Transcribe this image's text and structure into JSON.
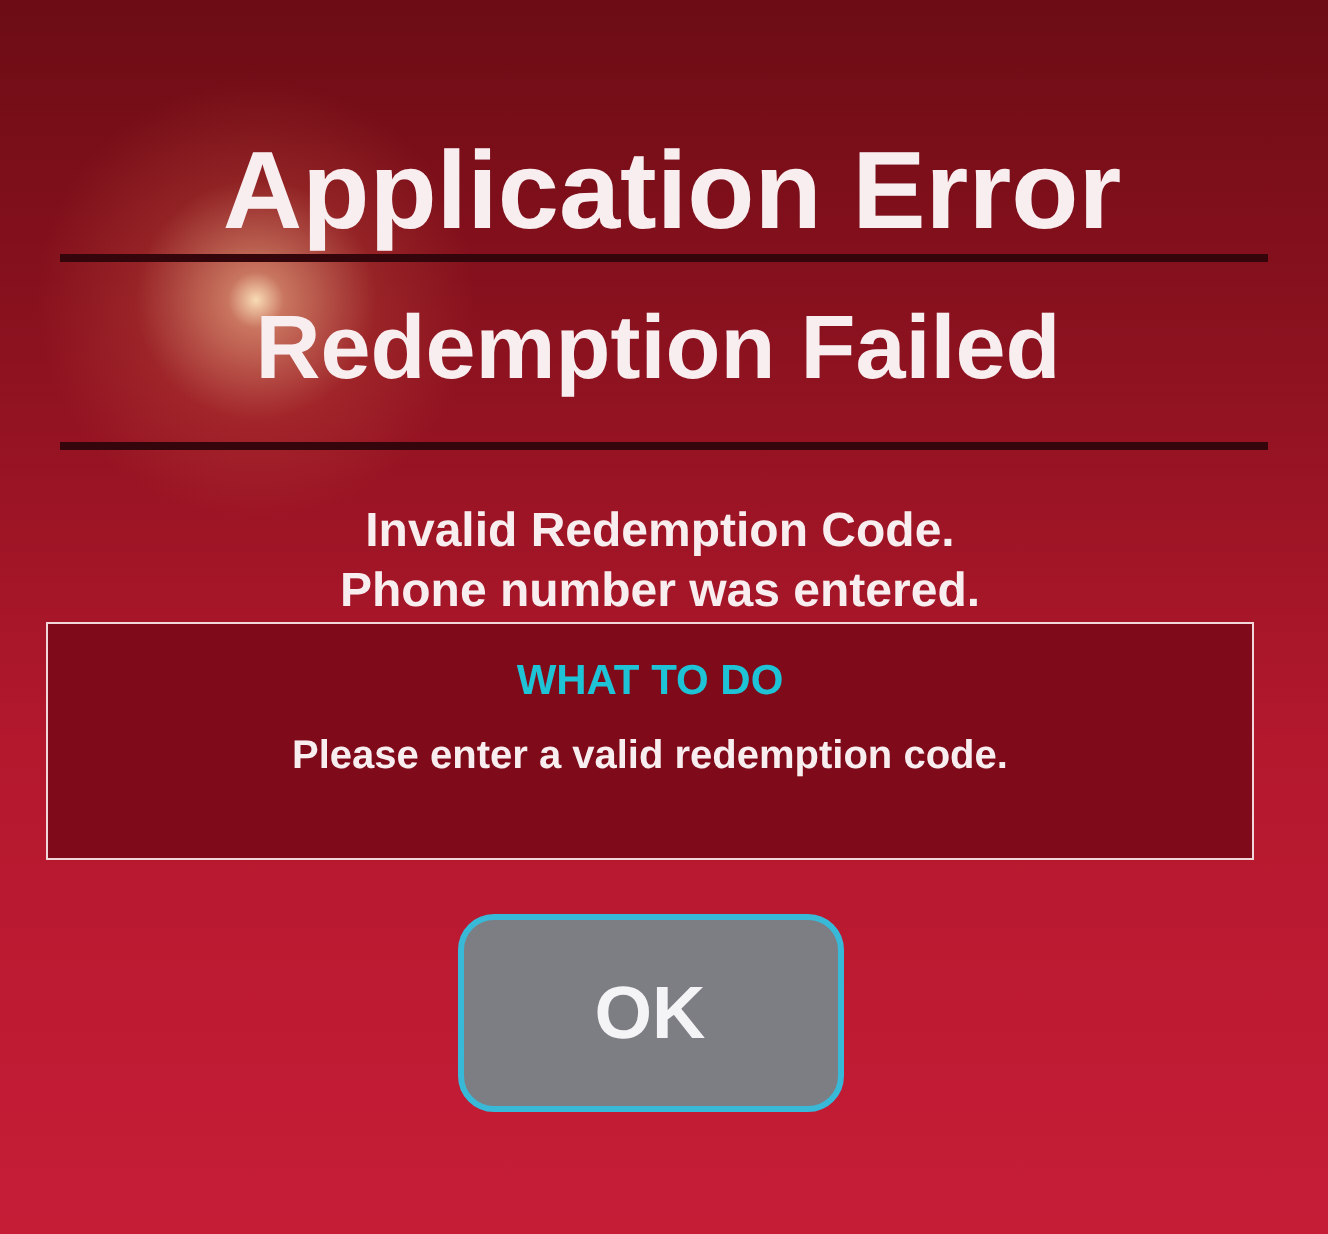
{
  "title": "Application Error",
  "subtitle": "Redemption Failed",
  "message": [
    "Invalid Redemption Code.",
    "Phone number was entered."
  ],
  "what_to_do": {
    "heading": "WHAT TO DO",
    "text": "Please enter a valid redemption code."
  },
  "buttons": [
    {
      "label": "OK"
    }
  ]
}
